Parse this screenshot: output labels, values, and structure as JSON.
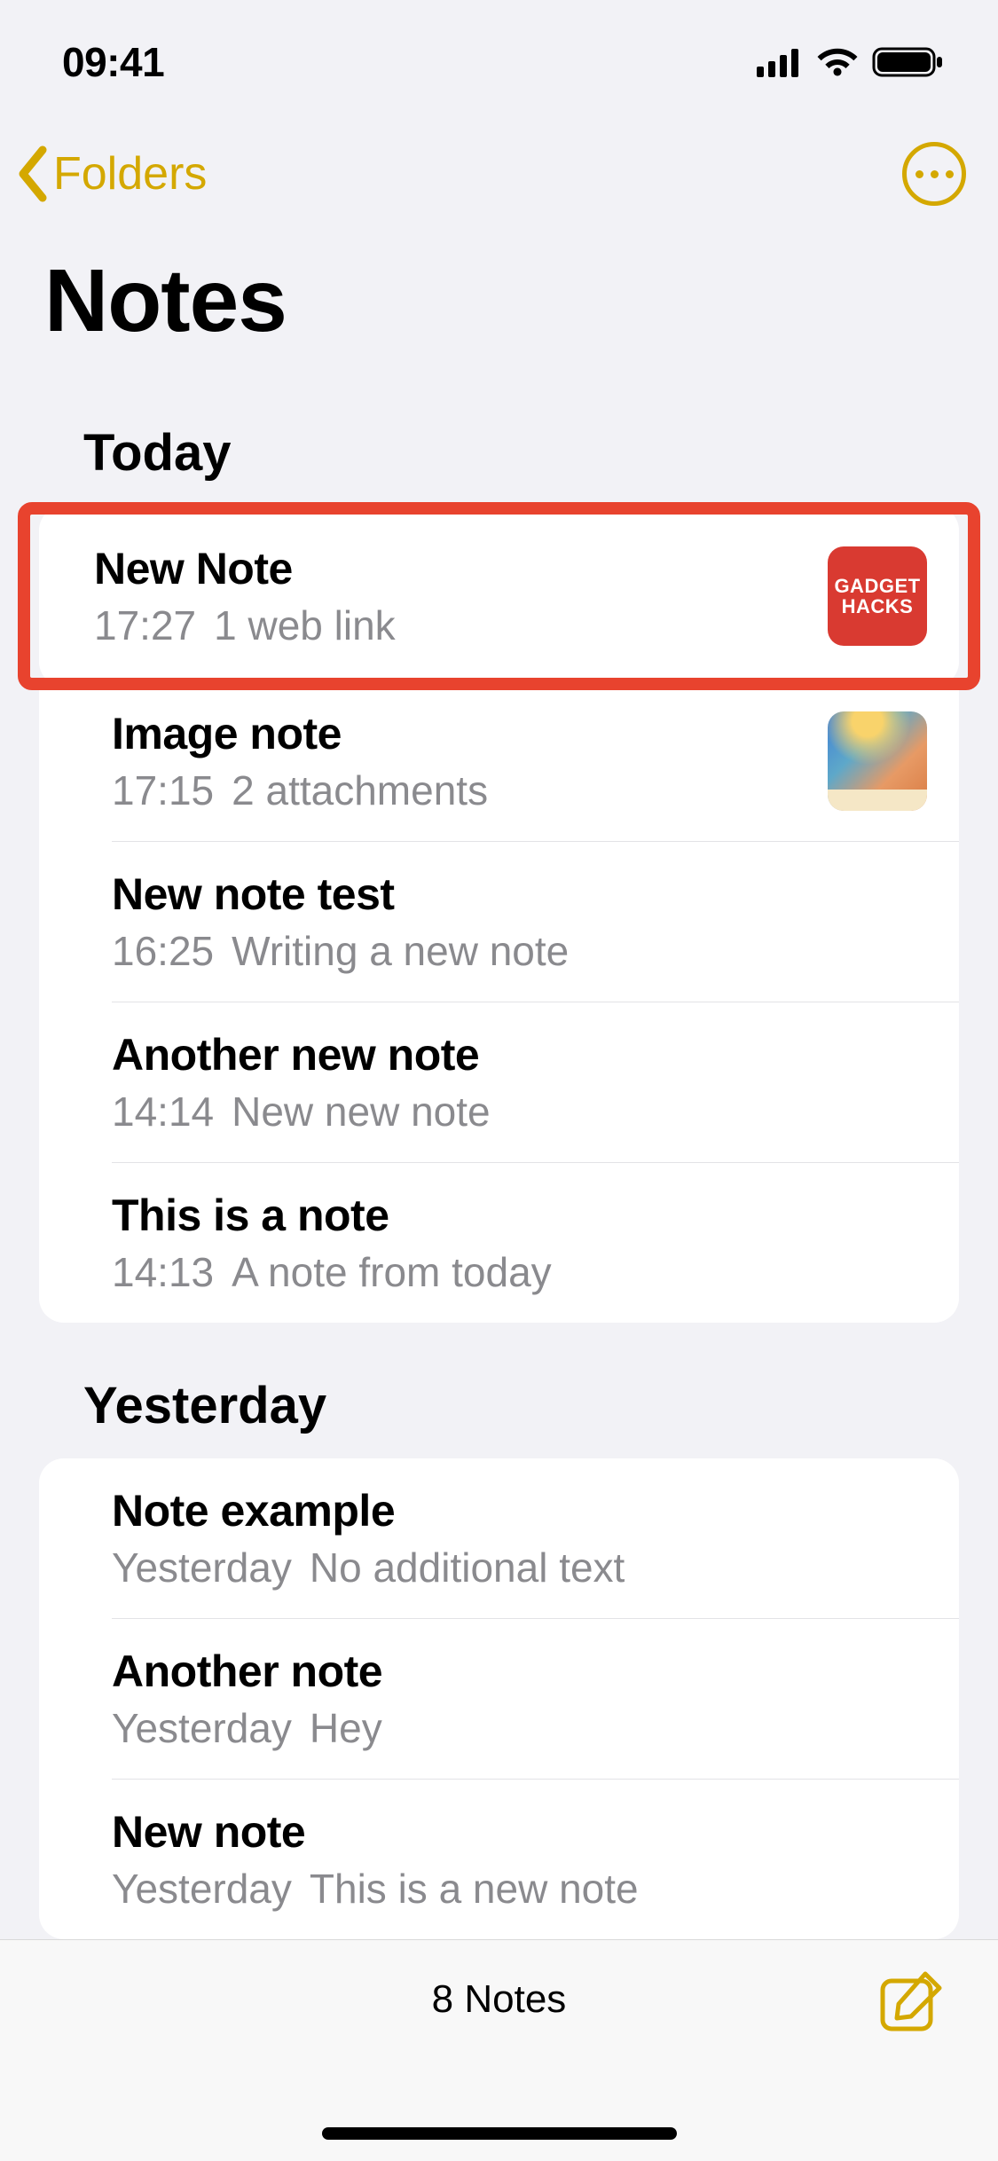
{
  "status": {
    "time": "09:41"
  },
  "nav": {
    "back_label": "Folders"
  },
  "title": "Notes",
  "sections": [
    {
      "heading": "Today",
      "notes": [
        {
          "title": "New Note",
          "time": "17:27",
          "snippet": "1 web link",
          "thumb": "gadget",
          "highlighted": true
        },
        {
          "title": "Image note",
          "time": "17:15",
          "snippet": "2 attachments",
          "thumb": "gradient"
        },
        {
          "title": "New note test",
          "time": "16:25",
          "snippet": "Writing a new note"
        },
        {
          "title": "Another new note",
          "time": "14:14",
          "snippet": "New new note"
        },
        {
          "title": "This is a note",
          "time": "14:13",
          "snippet": "A note from today"
        }
      ]
    },
    {
      "heading": "Yesterday",
      "notes": [
        {
          "title": "Note example",
          "time": "Yesterday",
          "snippet": "No additional text"
        },
        {
          "title": "Another note",
          "time": "Yesterday",
          "snippet": "Hey"
        },
        {
          "title": "New note",
          "time": "Yesterday",
          "snippet": "This is a new note"
        }
      ]
    }
  ],
  "toolbar": {
    "count_label": "8 Notes"
  },
  "thumb_text": {
    "gadget_line1": "GADGET",
    "gadget_line2": "HACKS"
  }
}
